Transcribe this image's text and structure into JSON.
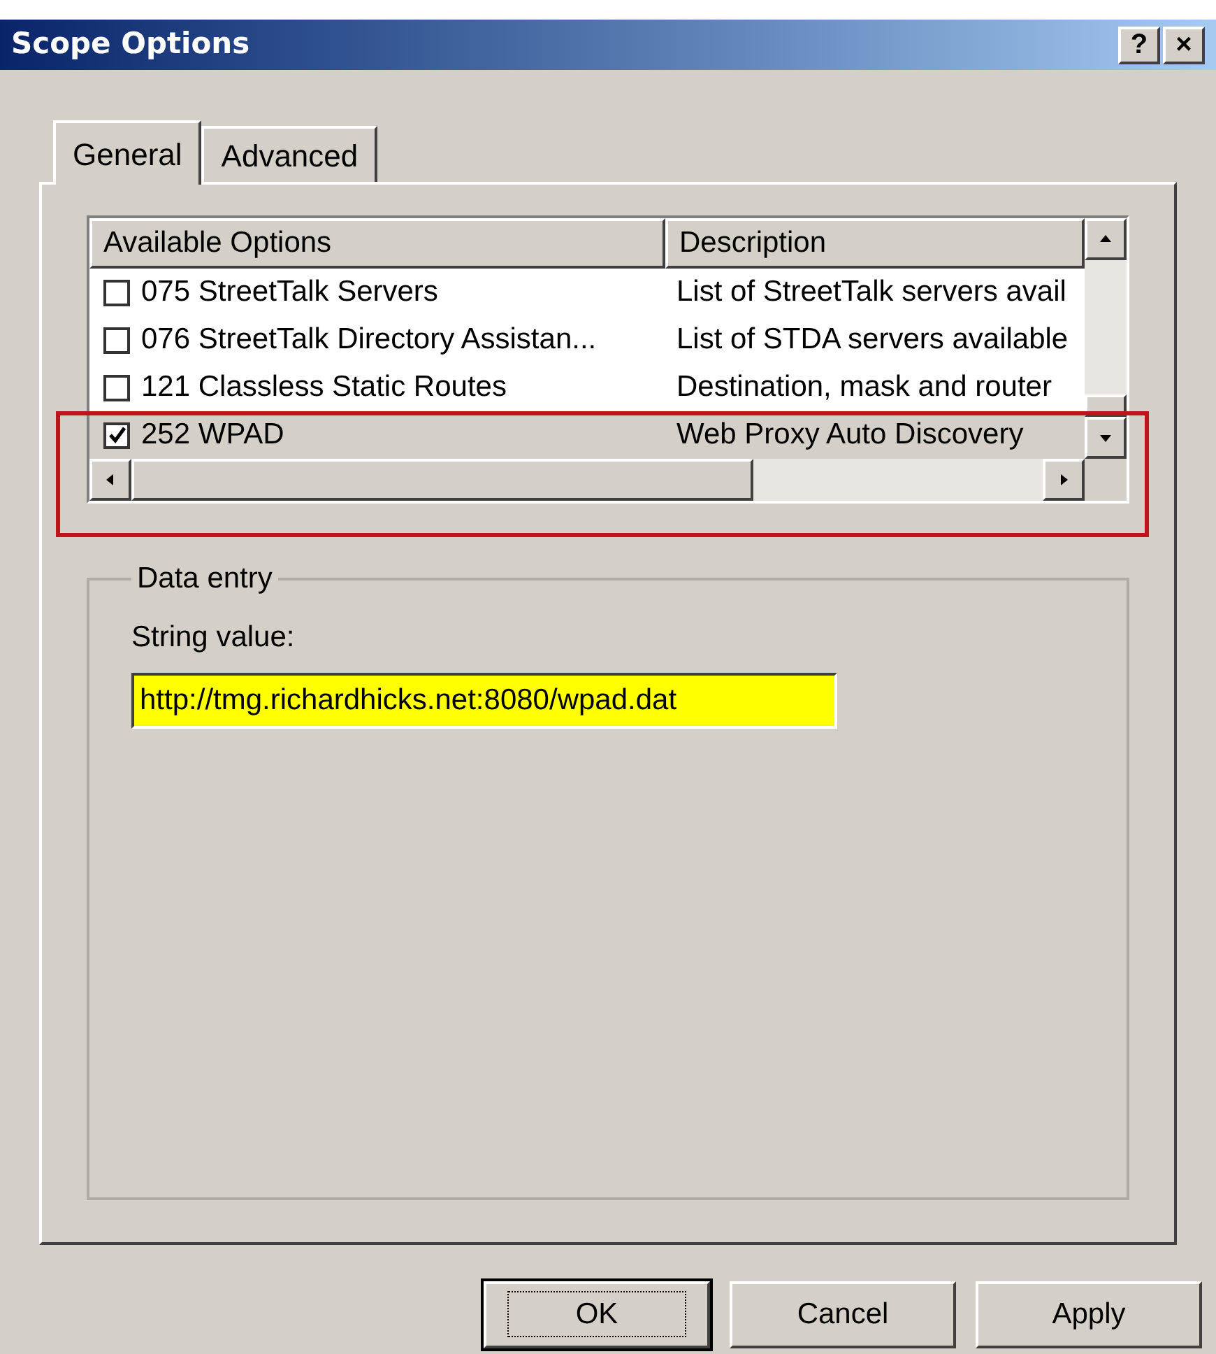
{
  "window": {
    "title": "Scope Options",
    "buttons": [
      {
        "label": "?"
      },
      {
        "label": "×"
      }
    ]
  },
  "tabs": [
    {
      "label": "General",
      "selected": true
    },
    {
      "label": "Advanced",
      "selected": false
    }
  ],
  "options_list": {
    "columns": [
      "Available Options",
      "Description"
    ],
    "rows": [
      {
        "option": "075 StreetTalk Servers",
        "description": "List of StreetTalk servers avail",
        "checked": false,
        "selected": false
      },
      {
        "option": "076 StreetTalk Directory Assistan...",
        "description": "List of STDA servers available",
        "checked": false,
        "selected": false
      },
      {
        "option": "121 Classless Static Routes",
        "description": "Destination, mask and router",
        "checked": false,
        "selected": false
      },
      {
        "option": "252 WPAD",
        "description": "Web Proxy Auto Discovery",
        "checked": true,
        "selected": true
      }
    ]
  },
  "annotation": {
    "kind": "rectangle",
    "color": "#c0141c"
  },
  "data_entry": {
    "title": "Data entry",
    "label": "String value:",
    "value": "http://tmg.richardhicks.net:8080/wpad.dat"
  },
  "buttons": [
    {
      "label": "OK",
      "default": true
    },
    {
      "label": "Cancel",
      "default": false
    },
    {
      "label": "Apply",
      "default": false
    }
  ]
}
